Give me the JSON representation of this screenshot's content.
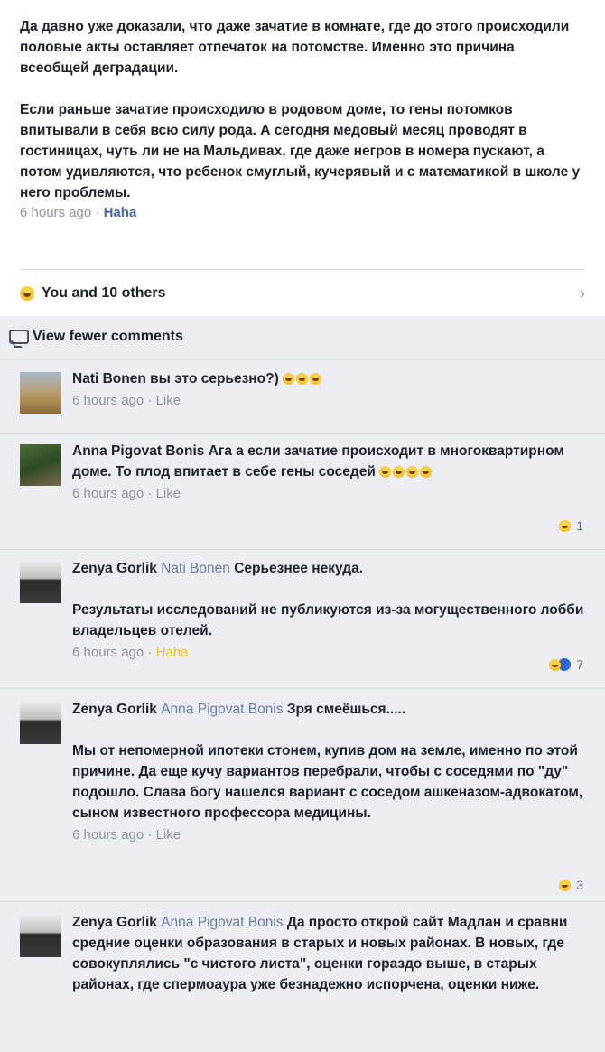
{
  "post": {
    "paragraph1": "Да давно уже доказали, что даже зачатие в комнате, где до этого происходили половые акты оставляет отпечаток на потомстве. Именно это причина всеобщей деградации.",
    "paragraph2": "Если раньше зачатие происходило в родовом доме, то гены потомков впитывали в себя всю силу рода. А сегодня медовый месяц проводят в гостиницах, чуть ли не на Мальдивах, где даже негров в номера пускают, а потом удивляются, что ребенок смуглый, кучерявый и с математикой в школе у него проблемы.",
    "time": "6 hours ago",
    "dot": "·",
    "reaction_label": "Haha",
    "reactions_summary": "You and 10 others",
    "chevron": "›"
  },
  "view_fewer_label": "View fewer comments",
  "comments": [
    {
      "author": "Nati Bonen",
      "tag": "",
      "text": "вы это серьезно?)",
      "time": "6 hours ago",
      "action": "Like",
      "reaction_count": ""
    },
    {
      "author": "Anna Pigovat Bonis",
      "tag": "",
      "text": "Ага а если зачатие происходит в многоквартирном доме. То плод впитает в себе гены соседей",
      "time": "6 hours ago",
      "action": "Like",
      "reaction_count": "1"
    },
    {
      "author": "Zenya Gorlik",
      "tag": "Nati Bonen",
      "text": "Серьезнее некуда.\n\nРезультаты исследований не публикуются из-за могущественного лобби владельцев отелей.",
      "time": "6 hours ago",
      "action": "Haha",
      "reaction_count": "7"
    },
    {
      "author": "Zenya Gorlik",
      "tag": "Anna Pigovat Bonis",
      "text": "Зря смеёшься.....\n\nМы от непомерной ипотеки стонем, купив дом на земле, именно по этой причине. Да еще кучу вариантов перебрали, чтобы с соседями по \"ду\" подошло. Слава богу нашелся вариант с соседом ашкеназом-адвокатом, сыном известного профессора медицины.",
      "time": "6 hours ago",
      "action": "Like",
      "reaction_count": "3"
    },
    {
      "author": "Zenya Gorlik",
      "tag": "Anna Pigovat Bonis",
      "text": "Да просто открой сайт Мадлан и сравни средние оценки образования в старых и новых районах. В новых, где совокуплялись \"с чистого листа\", оценки гораздо выше, в старых районах, где спермоаура уже безнадежно испорчена, оценки ниже.",
      "time": "",
      "action": "",
      "reaction_count": ""
    }
  ]
}
